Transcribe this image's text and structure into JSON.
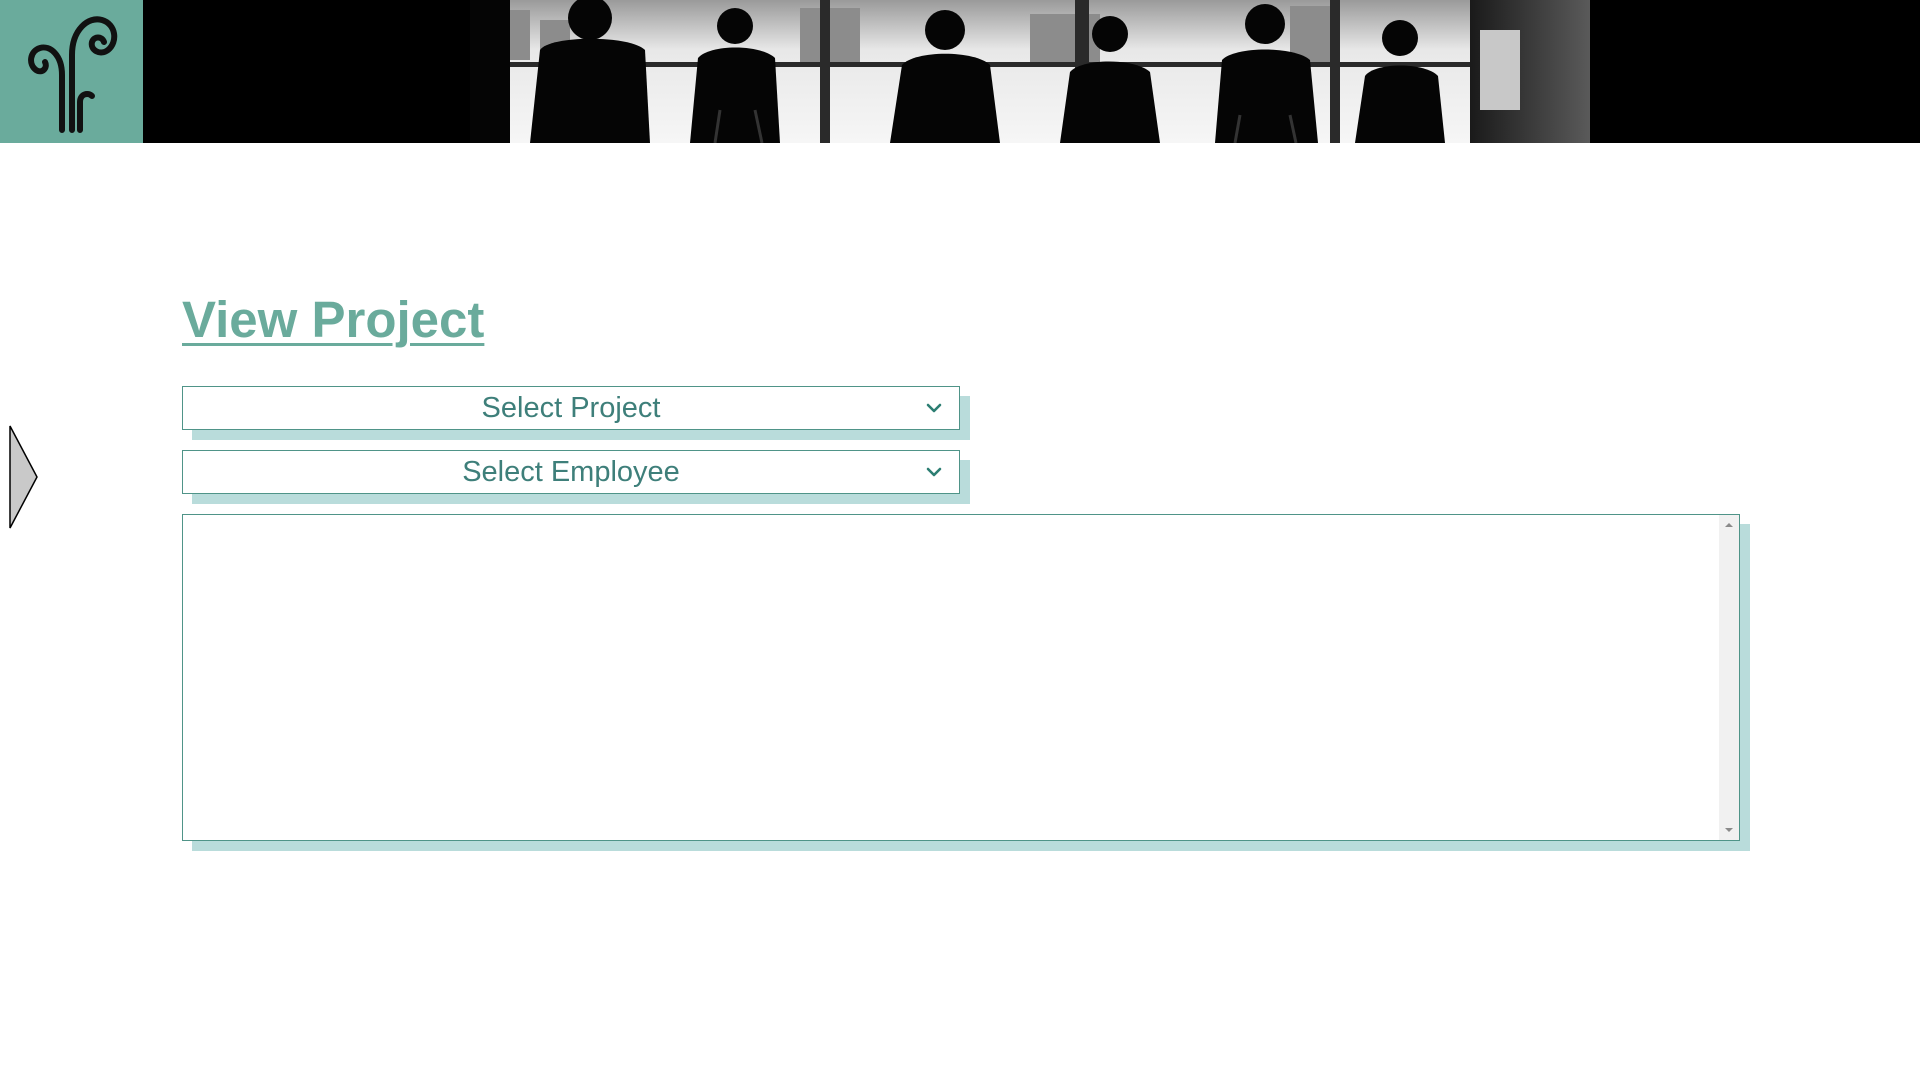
{
  "header": {
    "logo_icon": "fern-swirl-logo-icon",
    "banner_image": "office-meeting-silhouette-photo"
  },
  "side_nav": {
    "icon": "triangle-right-icon"
  },
  "main": {
    "title": "View Project",
    "project_select": {
      "selected": "Select Project",
      "icon": "chevron-down-icon"
    },
    "employee_select": {
      "selected": "Select Employee",
      "icon": "chevron-down-icon"
    },
    "detail_list": {
      "items": []
    }
  },
  "colors": {
    "accent": "#6aab9c",
    "border": "#4f9488",
    "text": "#3e7f7a",
    "shadow": "#b9dcdb",
    "header_bg": "#000000"
  }
}
